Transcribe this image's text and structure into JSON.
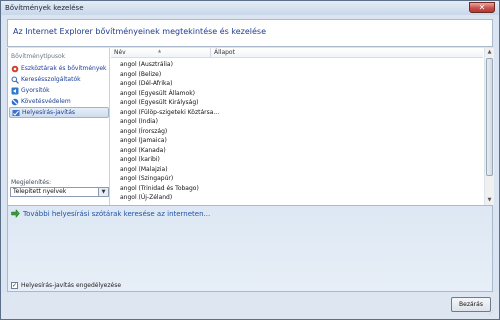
{
  "window": {
    "title": "Bővítmények kezelése",
    "close_glyph": "✕"
  },
  "header": {
    "title": "Az Internet Explorer bővítményeinek megtekintése és kezelése"
  },
  "sidebar": {
    "label": "Bővítménytípusok",
    "items": [
      {
        "label": "Eszköztárak és bővítmények",
        "icon": "gear-icon"
      },
      {
        "label": "Keresésszolgáltatók",
        "icon": "search-icon"
      },
      {
        "label": "Gyorsítók",
        "icon": "accelerator-icon"
      },
      {
        "label": "Követésvédelem",
        "icon": "block-icon"
      },
      {
        "label": "Helyesírás-javítás",
        "icon": "spellcheck-icon"
      }
    ],
    "display_label": "Megjelenítés:",
    "display_value": "Telepített nyelvek"
  },
  "list": {
    "col_name": "Név",
    "col_status": "Állapot",
    "rows": [
      "angol (Ausztrália)",
      "angol (Belize)",
      "angol (Dél-Afrika)",
      "angol (Egyesült Államok)",
      "angol (Egyesült Királyság)",
      "angol (Fülöp-szigeteki Köztársa...",
      "angol (India)",
      "angol (Írország)",
      "angol (Jamaica)",
      "angol (Kanada)",
      "angol (karibi)",
      "angol (Malajzia)",
      "angol (Szingapúr)",
      "angol (Trinidad és Tobago)",
      "angol (Új-Zéland)"
    ]
  },
  "lower": {
    "find_link": "További helyesírási szótárak keresése az interneten...",
    "checkbox_label": "Helyesírás-javítás engedélyezése",
    "checkbox_mark": "✓"
  },
  "footer": {
    "close_label": "Bezárás"
  },
  "colors": {
    "accent": "#1e3d8f",
    "link": "#1f51a8"
  }
}
